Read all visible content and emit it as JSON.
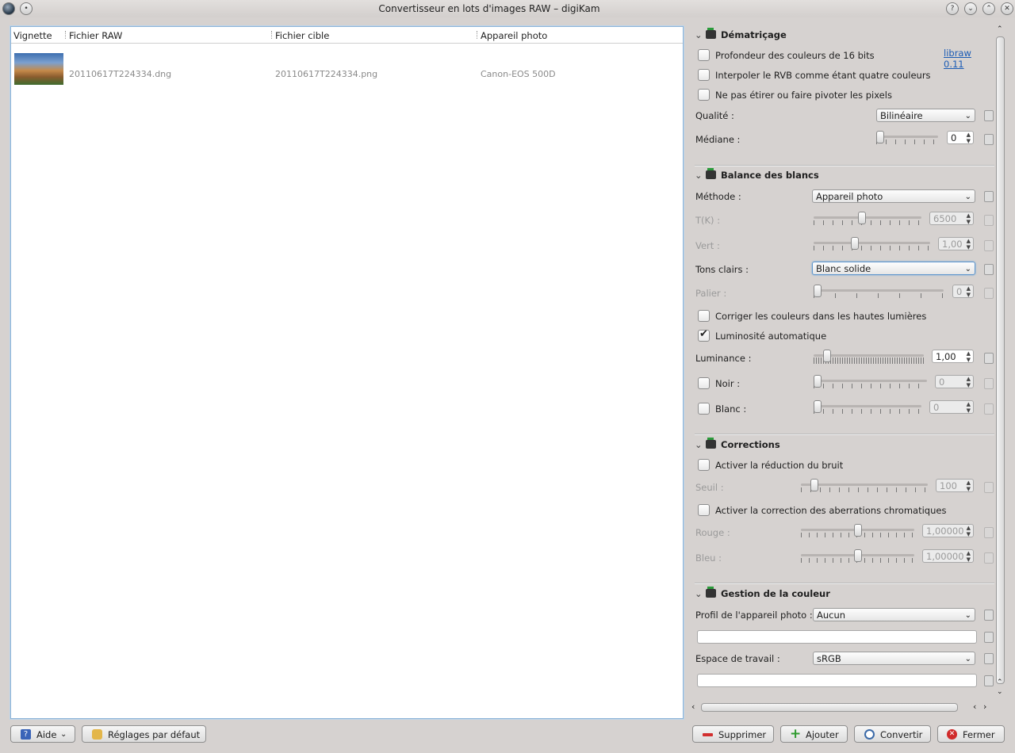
{
  "window": {
    "title": "Convertisseur en lots d'images RAW – digiKam"
  },
  "list": {
    "columns": [
      "Vignette",
      "Fichier RAW",
      "Fichier cible",
      "Appareil photo"
    ],
    "rows": [
      {
        "raw": "20110617T224334.dng",
        "target": "20110617T224334.png",
        "camera": "Canon-EOS 500D"
      }
    ]
  },
  "demosaic": {
    "title": "Dématriçage",
    "opt16bit": "Profondeur des couleurs de 16 bits",
    "libraw_link": "libraw 0.11",
    "opt4colors": "Interpoler le RVB comme étant quatre couleurs",
    "optNoStretch": "Ne pas étirer ou faire pivoter les pixels",
    "quality_label": "Qualité :",
    "quality_value": "Bilinéaire",
    "median_label": "Médiane :",
    "median_value": "0"
  },
  "whitebalance": {
    "title": "Balance des blancs",
    "method_label": "Méthode :",
    "method_value": "Appareil photo",
    "temp_label": "T(K) :",
    "temp_value": "6500",
    "green_label": "Vert :",
    "green_value": "1,00",
    "highlights_label": "Tons clairs :",
    "highlights_value": "Blanc solide",
    "level_label": "Palier :",
    "level_value": "0",
    "fixcolors": "Corriger les couleurs dans les hautes lumières",
    "autobright": "Luminosité automatique",
    "luminance_label": "Luminance :",
    "luminance_value": "1,00",
    "black_label": "Noir :",
    "black_value": "0",
    "white_label": "Blanc :",
    "white_value": "0"
  },
  "corrections": {
    "title": "Corrections",
    "noise": "Activer la réduction du bruit",
    "threshold_label": "Seuil :",
    "threshold_value": "100",
    "ca": "Activer la correction des aberrations chromatiques",
    "red_label": "Rouge :",
    "red_value": "1,00000",
    "blue_label": "Bleu :",
    "blue_value": "1,00000"
  },
  "color": {
    "title": "Gestion de la couleur",
    "camera_profile_label": "Profil de l'appareil photo :",
    "camera_profile_value": "Aucun",
    "workspace_label": "Espace de travail :",
    "workspace_value": "sRGB"
  },
  "buttons": {
    "help": "Aide",
    "defaults": "Réglages par défaut",
    "remove": "Supprimer",
    "add": "Ajouter",
    "convert": "Convertir",
    "close": "Fermer"
  },
  "checks": {
    "opt16bit": false,
    "opt4colors": false,
    "optNoStretch": false,
    "fixcolors": false,
    "autobright": true,
    "black": false,
    "white": false,
    "noise": false,
    "ca": false
  }
}
